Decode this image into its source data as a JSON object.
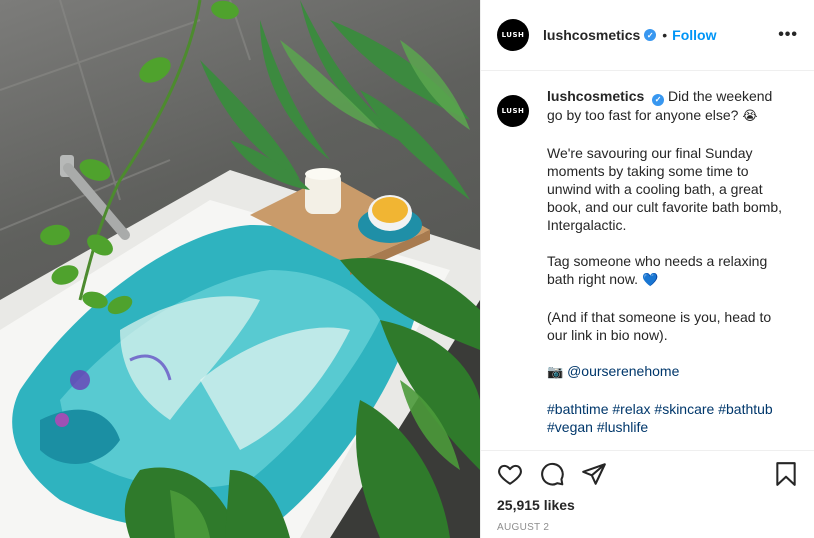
{
  "account": {
    "avatar_text": "LUSH",
    "username": "lushcosmetics",
    "verified_mark": "✓",
    "separator": "•",
    "follow_label": "Follow",
    "more_label": "•••"
  },
  "caption": {
    "username": "lushcosmetics",
    "line1": "Did the weekend go by too fast for anyone else?",
    "emoji1": "😭",
    "paragraph2": "We're savouring our final Sunday moments by taking some time to unwind with a cooling bath, a great book, and our cult favorite bath bomb, Intergalactic.",
    "paragraph3": "Tag someone who needs a relaxing bath right now.",
    "emoji3": "💙",
    "paragraph4": "(And if that someone is you, head to our link in bio now).",
    "camera_emoji": "📷",
    "mention": "@ourserenehome",
    "hashtags": [
      "#bathtime",
      "#relax",
      "#skincare",
      "#bathtub",
      "#vegan",
      "#lushlife"
    ]
  },
  "actions": {
    "icons": [
      "heart-icon",
      "comment-icon",
      "share-icon",
      "bookmark-icon"
    ],
    "likes": "25,915 likes",
    "date": "AUGUST 2"
  },
  "colors": {
    "accent": "#0095f6",
    "verified": "#3897f0",
    "hashtag": "#00376b",
    "muted": "#8e8e8e"
  }
}
